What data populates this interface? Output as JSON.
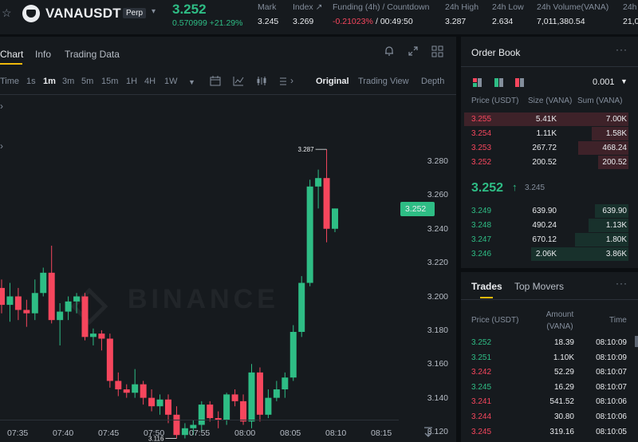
{
  "header": {
    "symbol": "VANAUSDT",
    "contract_badge": "Perp",
    "last_price": "3.252",
    "change": "0.570999 +21.29%",
    "stats": [
      {
        "label": "Mark",
        "value": "3.245"
      },
      {
        "label": "Index ↗",
        "value": "3.269"
      },
      {
        "label": "Funding (4h) / Countdown",
        "value": "-0.21023%",
        "value2": " / 00:49:50"
      },
      {
        "label": "24h High",
        "value": "3.287"
      },
      {
        "label": "24h Low",
        "value": "2.634"
      },
      {
        "label": "24h Volume(VANA)",
        "value": "7,011,380.54"
      },
      {
        "label": "24h",
        "value": "21,0"
      }
    ]
  },
  "chart_tabs": [
    "Chart",
    "Info",
    "Trading Data"
  ],
  "toolbar": {
    "time_label": "Time",
    "intervals": [
      "1s",
      "1m",
      "3m",
      "5m",
      "15m",
      "1H",
      "4H",
      "1W"
    ],
    "active_interval": "1m",
    "views": [
      "Original",
      "Trading View",
      "Depth"
    ],
    "active_view": "Original"
  },
  "watermark": "BINANCE",
  "chart": {
    "y_ticks": [
      "3.280",
      "3.260",
      "3.240",
      "3.220",
      "3.200",
      "3.180",
      "3.160",
      "3.140",
      "3.120"
    ],
    "x_ticks": [
      "07:35",
      "07:40",
      "07:45",
      "07:50",
      "07:55",
      "08:00",
      "08:05",
      "08:10",
      "08:15"
    ],
    "price_tag": "3.252",
    "high_marker": "3.287",
    "low_marker": "3.116"
  },
  "chart_data": {
    "type": "candlestick",
    "title": "VANAUSDT 1m",
    "ylim": [
      3.11,
      3.29
    ],
    "up_color": "#2ebd85",
    "down_color": "#f6465d",
    "candles": [
      {
        "o": 3.205,
        "h": 3.21,
        "c": 3.195,
        "l": 3.19
      },
      {
        "o": 3.195,
        "h": 3.208,
        "c": 3.2,
        "l": 3.185
      },
      {
        "o": 3.2,
        "h": 3.205,
        "c": 3.192,
        "l": 3.186
      },
      {
        "o": 3.192,
        "h": 3.198,
        "c": 3.19,
        "l": 3.182
      },
      {
        "o": 3.19,
        "h": 3.21,
        "c": 3.202,
        "l": 3.186
      },
      {
        "o": 3.202,
        "h": 3.217,
        "c": 3.214,
        "l": 3.2
      },
      {
        "o": 3.214,
        "h": 3.23,
        "c": 3.186,
        "l": 3.184
      },
      {
        "o": 3.186,
        "h": 3.196,
        "c": 3.191,
        "l": 3.171
      },
      {
        "o": 3.191,
        "h": 3.2,
        "c": 3.197,
        "l": 3.186
      },
      {
        "o": 3.197,
        "h": 3.202,
        "c": 3.2,
        "l": 3.19
      },
      {
        "o": 3.2,
        "h": 3.202,
        "c": 3.176,
        "l": 3.174
      },
      {
        "o": 3.176,
        "h": 3.181,
        "c": 3.178,
        "l": 3.171
      },
      {
        "o": 3.178,
        "h": 3.18,
        "c": 3.175,
        "l": 3.168
      },
      {
        "o": 3.175,
        "h": 3.178,
        "c": 3.15,
        "l": 3.146
      },
      {
        "o": 3.15,
        "h": 3.155,
        "c": 3.145,
        "l": 3.141
      },
      {
        "o": 3.145,
        "h": 3.148,
        "c": 3.143,
        "l": 3.14
      },
      {
        "o": 3.143,
        "h": 3.157,
        "c": 3.148,
        "l": 3.14
      },
      {
        "o": 3.148,
        "h": 3.15,
        "c": 3.14,
        "l": 3.136
      },
      {
        "o": 3.14,
        "h": 3.145,
        "c": 3.135,
        "l": 3.132
      },
      {
        "o": 3.135,
        "h": 3.142,
        "c": 3.139,
        "l": 3.13
      },
      {
        "o": 3.139,
        "h": 3.142,
        "c": 3.13,
        "l": 3.125
      },
      {
        "o": 3.13,
        "h": 3.135,
        "c": 3.118,
        "l": 3.116
      },
      {
        "o": 3.118,
        "h": 3.125,
        "c": 3.122,
        "l": 3.116
      },
      {
        "o": 3.122,
        "h": 3.127,
        "c": 3.124,
        "l": 3.118
      },
      {
        "o": 3.124,
        "h": 3.138,
        "c": 3.136,
        "l": 3.12
      },
      {
        "o": 3.136,
        "h": 3.138,
        "c": 3.128,
        "l": 3.126
      },
      {
        "o": 3.128,
        "h": 3.132,
        "c": 3.127,
        "l": 3.122
      },
      {
        "o": 3.127,
        "h": 3.143,
        "c": 3.142,
        "l": 3.124
      },
      {
        "o": 3.142,
        "h": 3.145,
        "c": 3.138,
        "l": 3.135
      },
      {
        "o": 3.138,
        "h": 3.142,
        "c": 3.126,
        "l": 3.124
      },
      {
        "o": 3.126,
        "h": 3.16,
        "c": 3.155,
        "l": 3.122
      },
      {
        "o": 3.155,
        "h": 3.158,
        "c": 3.13,
        "l": 3.126
      },
      {
        "o": 3.13,
        "h": 3.145,
        "c": 3.14,
        "l": 3.128
      },
      {
        "o": 3.14,
        "h": 3.15,
        "c": 3.145,
        "l": 3.138
      },
      {
        "o": 3.145,
        "h": 3.155,
        "c": 3.152,
        "l": 3.14
      },
      {
        "o": 3.152,
        "h": 3.183,
        "c": 3.179,
        "l": 3.15
      },
      {
        "o": 3.179,
        "h": 3.212,
        "c": 3.208,
        "l": 3.176
      },
      {
        "o": 3.208,
        "h": 3.269,
        "c": 3.265,
        "l": 3.206
      },
      {
        "o": 3.265,
        "h": 3.275,
        "c": 3.27,
        "l": 3.252
      },
      {
        "o": 3.27,
        "h": 3.287,
        "c": 3.24,
        "l": 3.232
      },
      {
        "o": 3.24,
        "h": 3.252,
        "c": 3.252,
        "l": 3.238
      }
    ]
  },
  "orderbook": {
    "title": "Order Book",
    "precision": "0.001",
    "headers": [
      "Price (USDT)",
      "Size (VANA)",
      "Sum (VANA)"
    ],
    "asks": [
      {
        "price": "3.255",
        "size": "5.41K",
        "sum": "7.00K",
        "depth": 0.98
      },
      {
        "price": "3.254",
        "size": "1.11K",
        "sum": "1.58K",
        "depth": 0.22
      },
      {
        "price": "3.253",
        "size": "267.72",
        "sum": "468.24",
        "depth": 0.3
      },
      {
        "price": "3.252",
        "size": "200.52",
        "sum": "200.52",
        "depth": 0.18
      }
    ],
    "mid_price": "3.252",
    "mid_arrow": "↑",
    "mid_mark": "3.245",
    "bids": [
      {
        "price": "3.249",
        "size": "639.90",
        "sum": "639.90",
        "depth": 0.2
      },
      {
        "price": "3.248",
        "size": "490.24",
        "sum": "1.13K",
        "depth": 0.24
      },
      {
        "price": "3.247",
        "size": "670.12",
        "sum": "1.80K",
        "depth": 0.32
      },
      {
        "price": "3.246",
        "size": "2.06K",
        "sum": "3.86K",
        "depth": 0.58
      }
    ]
  },
  "trades": {
    "tabs": [
      "Trades",
      "Top Movers"
    ],
    "headers": [
      "Price (USDT)",
      "Amount (VANA)",
      "Time"
    ],
    "rows": [
      {
        "price": "3.252",
        "amount": "18.39",
        "time": "08:10:09",
        "side": "buy"
      },
      {
        "price": "3.251",
        "amount": "1.10K",
        "time": "08:10:09",
        "side": "buy"
      },
      {
        "price": "3.242",
        "amount": "52.29",
        "time": "08:10:07",
        "side": "sell"
      },
      {
        "price": "3.245",
        "amount": "16.29",
        "time": "08:10:07",
        "side": "buy"
      },
      {
        "price": "3.241",
        "amount": "541.52",
        "time": "08:10:06",
        "side": "sell"
      },
      {
        "price": "3.244",
        "amount": "30.80",
        "time": "08:10:06",
        "side": "sell"
      },
      {
        "price": "3.245",
        "amount": "319.16",
        "time": "08:10:05",
        "side": "sell"
      }
    ]
  }
}
